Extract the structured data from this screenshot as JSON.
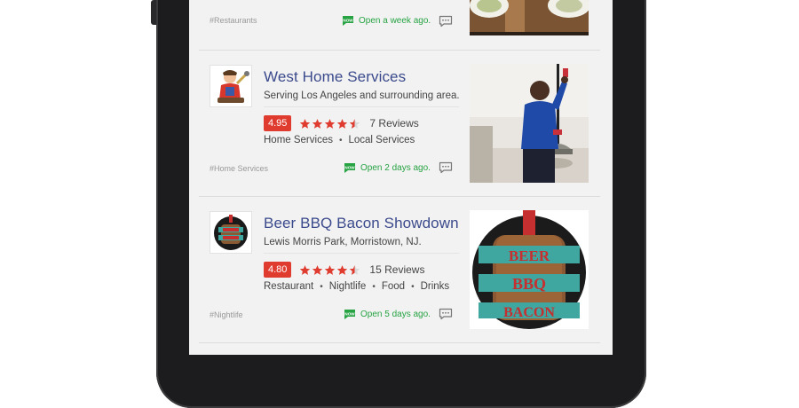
{
  "listings": [
    {
      "tag": "#Restaurants",
      "status": "Open a week ago."
    },
    {
      "title": "West Home Services",
      "subtitle": "Serving Los Angeles and surrounding area.",
      "score": "4.95",
      "reviews": "7 Reviews",
      "categories": [
        "Home Services",
        "Local Services"
      ],
      "tag": "#Home Services",
      "status": "Open 2 days ago.",
      "stars": 4.5
    },
    {
      "title": "Beer BBQ Bacon Showdown",
      "subtitle": "Lewis Morris Park, Morristown, NJ.",
      "score": "4.80",
      "reviews": "15 Reviews",
      "categories": [
        "Restaurant",
        "Nightlife",
        "Food",
        "Drinks"
      ],
      "tag": "#Nightlife",
      "status": "Open 5 days ago.",
      "stars": 4.5,
      "logo_text": [
        "BEER",
        "BBQ",
        "BACON"
      ]
    }
  ],
  "badge_text": "NOW",
  "colors": {
    "accent_red": "#e03b2f",
    "title_blue": "#3b4a8c",
    "status_green": "#27a343"
  }
}
